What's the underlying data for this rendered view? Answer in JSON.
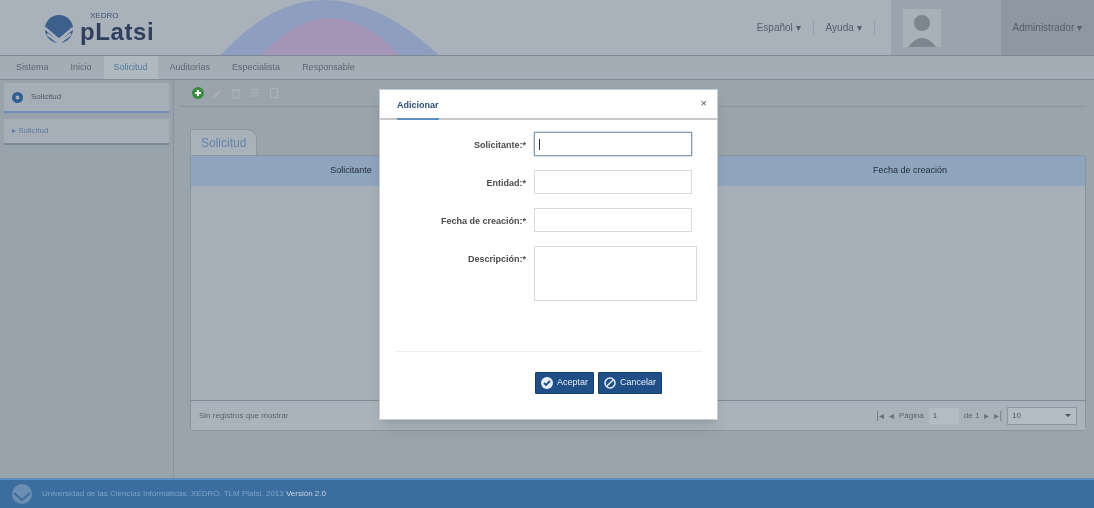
{
  "header": {
    "logo_text": "pLatsi",
    "logo_subtext": "XEDRO",
    "menus": [
      {
        "label": "Español",
        "caret": "▾"
      },
      {
        "label": "Ayuda",
        "caret": "▾"
      }
    ],
    "user": {
      "label": "Administrador",
      "caret": "▾"
    }
  },
  "nav": [
    {
      "label": "Sistema",
      "selected": false
    },
    {
      "label": "Inicio",
      "selected": false
    },
    {
      "label": "Solicitud",
      "selected": true
    },
    {
      "label": "Auditorías",
      "selected": false
    },
    {
      "label": "Especialista",
      "selected": false
    },
    {
      "label": "Responsable",
      "selected": false
    }
  ],
  "sidebar": {
    "title": "Solicitud",
    "items": [
      {
        "label": "Solicitud",
        "arrow": "▸"
      }
    ]
  },
  "toolbar": [
    {
      "kind": "add",
      "disabled": false
    },
    {
      "kind": "edit",
      "disabled": true
    },
    {
      "kind": "delete",
      "disabled": true
    },
    {
      "kind": "list",
      "disabled": true
    },
    {
      "kind": "save",
      "disabled": true
    }
  ],
  "tab": {
    "label": "Solicitud"
  },
  "table": {
    "columns": [
      "Solicitante",
      "Fecha de creación"
    ]
  },
  "pager": {
    "empty_text": "Sin registros que mostrar",
    "first": "|◂",
    "prev": "◂",
    "page_label": "Página",
    "page": "1",
    "of_label": "de 1",
    "next": "▸",
    "last": "▸|",
    "page_size": "10"
  },
  "dialog": {
    "title": "Adicionar",
    "close": "×",
    "fields": [
      {
        "label": "Solicitante:*",
        "kind": "text",
        "focused": true
      },
      {
        "label": "Entidad:*",
        "kind": "text",
        "focused": false
      },
      {
        "label": "Fecha de creación:*",
        "kind": "text",
        "focused": false
      },
      {
        "label": "Descripción:*",
        "kind": "textarea",
        "focused": false
      }
    ],
    "buttons": [
      {
        "label": "Aceptar",
        "kind": "accept"
      },
      {
        "label": "Cancelar",
        "kind": "cancel"
      }
    ]
  },
  "footer": {
    "text": "Universidad de las Ciencias Informáticas. XEDRO. TLM Platsi. 2013 ",
    "version": "Versión 2.0"
  }
}
